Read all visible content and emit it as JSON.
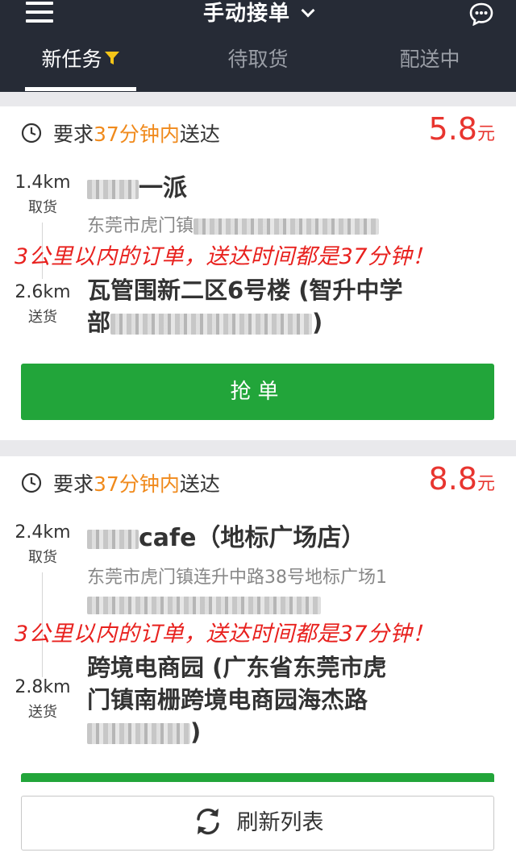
{
  "header": {
    "title": "手动接单",
    "tabs": [
      {
        "label": "新任务",
        "active": true
      },
      {
        "label": "待取货",
        "active": false
      },
      {
        "label": "配送中",
        "active": false
      }
    ]
  },
  "orders": [
    {
      "req_prefix": "要求",
      "req_time": "37分钟内",
      "req_suffix": "送达",
      "price": "5.8",
      "unit": "元",
      "pickup_dist": "1.4km",
      "pickup_label": "取货",
      "shop_name": "一派",
      "shop_address": "东莞市虎门镇",
      "notice": "3公里以内的订单，送达时间都是37分钟！",
      "delivery_dist": "2.6km",
      "delivery_label": "送货",
      "dest_line1": "瓦管围新二区6号楼 (智升中学",
      "dest_line2_start": "部",
      "dest_line2_end": ")",
      "grab_label": "抢单"
    },
    {
      "req_prefix": "要求",
      "req_time": "37分钟内",
      "req_suffix": "送达",
      "price": "8.8",
      "unit": "元",
      "pickup_dist": "2.4km",
      "pickup_label": "取货",
      "shop_name": "cafe（地标广场店）",
      "shop_address": "东莞市虎门镇连升中路38号地标广场1",
      "notice": "3公里以内的订单，送达时间都是37分钟！",
      "delivery_dist": "2.8km",
      "delivery_label": "送货",
      "dest_line1": "跨境电商园 (广东省东莞市虎",
      "dest_line2": "门镇南栅跨境电商园海杰路",
      "dest_line3_end": ")"
    }
  ],
  "refresh_label": "刷新列表",
  "colors": {
    "header_bg": "#262b36",
    "accent_orange": "#f08a1c",
    "price_red": "#e8352f",
    "notice_red": "#e8211e",
    "button_green": "#22a53a"
  }
}
